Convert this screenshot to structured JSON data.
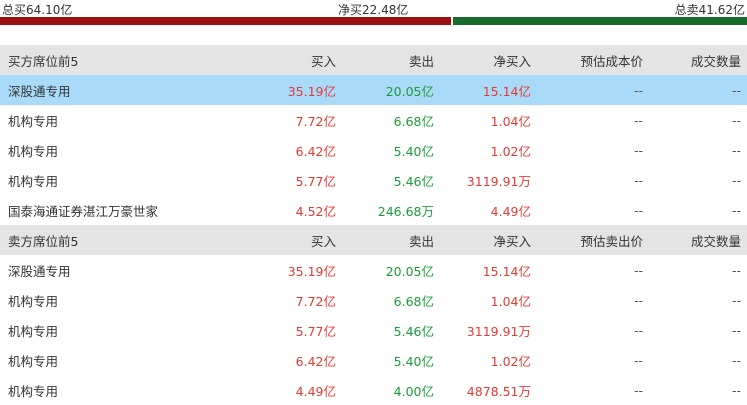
{
  "summary": {
    "total_buy": "总买64.10亿",
    "net_buy": "净买22.48亿",
    "total_sell": "总卖41.62亿",
    "buy_fraction": 0.606,
    "colors": {
      "buy": "#9a0f0f",
      "sell": "#1b6b2c"
    }
  },
  "buy_section": {
    "headers": [
      "买方席位前5",
      "买入",
      "卖出",
      "净买入",
      "预估成本价",
      "成交数量"
    ],
    "rows": [
      {
        "name": "深股通专用",
        "buy": "35.19亿",
        "sell": "20.05亿",
        "net": "15.14亿",
        "cost": "--",
        "volume": "--",
        "selected": true
      },
      {
        "name": "机构专用",
        "buy": "7.72亿",
        "sell": "6.68亿",
        "net": "1.04亿",
        "cost": "--",
        "volume": "--"
      },
      {
        "name": "机构专用",
        "buy": "6.42亿",
        "sell": "5.40亿",
        "net": "1.02亿",
        "cost": "--",
        "volume": "--"
      },
      {
        "name": "机构专用",
        "buy": "5.77亿",
        "sell": "5.46亿",
        "net": "3119.91万",
        "cost": "--",
        "volume": "--"
      },
      {
        "name": "国泰海通证券湛江万豪世家",
        "buy": "4.52亿",
        "sell": "246.68万",
        "net": "4.49亿",
        "cost": "--",
        "volume": "--"
      }
    ]
  },
  "sell_section": {
    "headers": [
      "卖方席位前5",
      "买入",
      "卖出",
      "净买入",
      "预估卖出价",
      "成交数量"
    ],
    "rows": [
      {
        "name": "深股通专用",
        "buy": "35.19亿",
        "sell": "20.05亿",
        "net": "15.14亿",
        "cost": "--",
        "volume": "--"
      },
      {
        "name": "机构专用",
        "buy": "7.72亿",
        "sell": "6.68亿",
        "net": "1.04亿",
        "cost": "--",
        "volume": "--"
      },
      {
        "name": "机构专用",
        "buy": "5.77亿",
        "sell": "5.46亿",
        "net": "3119.91万",
        "cost": "--",
        "volume": "--"
      },
      {
        "name": "机构专用",
        "buy": "6.42亿",
        "sell": "5.40亿",
        "net": "1.02亿",
        "cost": "--",
        "volume": "--"
      },
      {
        "name": "机构专用",
        "buy": "4.49亿",
        "sell": "4.00亿",
        "net": "4878.51万",
        "cost": "--",
        "volume": "--"
      }
    ]
  }
}
